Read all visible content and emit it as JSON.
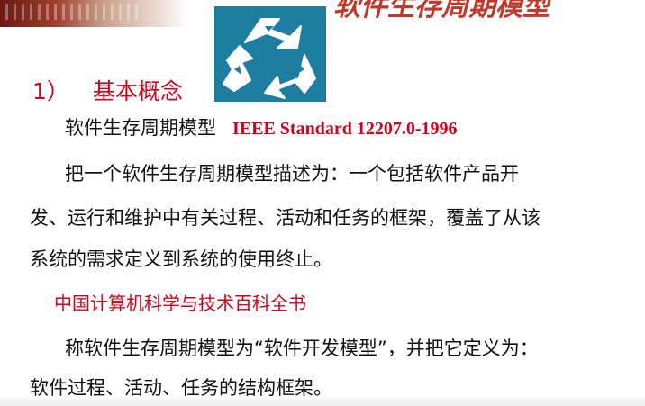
{
  "slide": {
    "title": "软件生存周期模型",
    "heading": {
      "number": "1）",
      "text": "基本概念"
    },
    "line1": {
      "term": "软件生存周期模型",
      "standard": "IEEE Standard 12207.0-1996"
    },
    "para1": [
      "把一个软件生存周期模型描述为：一个包括软件产品开",
      "发、运行和维护中有关过程、活动和任务的框架，覆盖了从该",
      "系统的需求定义到系统的使用终止。"
    ],
    "source2": "中国计算机科学与技术百科全书",
    "para2": [
      "称软件生存周期模型为“软件开发模型”，并把它定义为：",
      "软件过程、活动、任务的结构框架。"
    ]
  },
  "colors": {
    "accent_red": "#d0021b",
    "logo_blue": "#1d7ea2",
    "text": "#111111"
  },
  "icons": {
    "logo": "recycle-icon"
  }
}
